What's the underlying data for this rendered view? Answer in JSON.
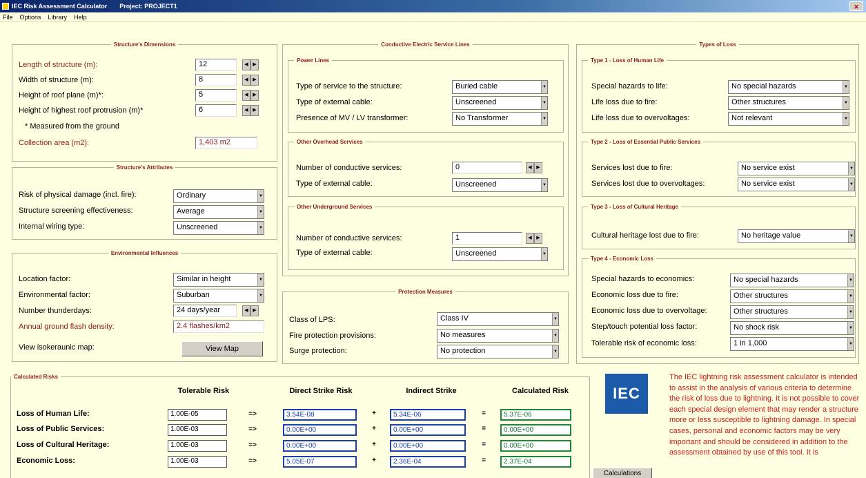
{
  "window": {
    "title": "IEC Risk Assessment Calculator",
    "project": "Project: PROJECT1",
    "close": "✕"
  },
  "menu": [
    "File",
    "Options",
    "Library",
    "Help"
  ],
  "dimensions": {
    "legend": "Structure's Dimensions",
    "length_label": "Length of structure (m):",
    "length_value": "12",
    "width_label": "Width of structure (m):",
    "width_value": "8",
    "height_label": "Height of roof plane (m)*:",
    "height_value": "5",
    "protrusion_label": "Height of highest roof protrusion (m)*",
    "protrusion_value": "6",
    "note": "* Measured from the ground",
    "collection_label": "Collection area (m2):",
    "collection_value": "1,403 m2"
  },
  "attributes": {
    "legend": "Structure's Attributes",
    "risk_label": "Risk of physical damage (incl. fire):",
    "risk_value": "Ordinary",
    "screening_label": "Structure screening effectiveness:",
    "screening_value": "Average",
    "wiring_label": "Internal wiring type:",
    "wiring_value": "Unscreened"
  },
  "environment": {
    "legend": "Environmental Influences",
    "location_label": "Location factor:",
    "location_value": "Similar in height",
    "env_label": "Environmental factor:",
    "env_value": "Suburban",
    "thunder_label": "Number thunderdays:",
    "thunder_value": "24 days/year",
    "flash_label": "Annual ground flash density:",
    "flash_value": "2.4  flashes/km2",
    "map_label": "View isokeraunic map:",
    "map_button": "View Map"
  },
  "services": {
    "legend": "Conductive Electric Service Lines",
    "power_legend": "Power Lines",
    "service_type_label": "Type of service to the structure:",
    "service_type_value": "Buried cable",
    "ext_cable_label": "Type of external cable:",
    "ext_cable_value": "Unscreened",
    "transformer_label": "Presence of MV / LV transformer:",
    "transformer_value": "No Transformer",
    "overhead_legend": "Other Overhead Services",
    "oh_count_label": "Number of conductive services:",
    "oh_count_value": "0",
    "oh_cable_label": "Type of external cable:",
    "oh_cable_value": "Unscreened",
    "ug_legend": "Other Underground Services",
    "ug_count_label": "Number of conductive services:",
    "ug_count_value": "1",
    "ug_cable_label": "Type of external cable:",
    "ug_cable_value": "Unscreened"
  },
  "protection": {
    "legend": "Protection Measures",
    "lps_label": "Class of LPS:",
    "lps_value": "Class IV",
    "fire_label": "Fire protection provisions:",
    "fire_value": "No measures",
    "surge_label": "Surge protection:",
    "surge_value": "No protection"
  },
  "loss": {
    "legend": "Types of Loss",
    "t1_legend": "Type 1 - Loss of Human Life",
    "special_label": "Special hazards to life:",
    "special_value": "No special hazards",
    "lifefire_label": "Life loss due to fire:",
    "lifefire_value": "Other structures",
    "lifeover_label": "Life loss due to overvoltages:",
    "lifeover_value": "Not relevant",
    "t2_legend": "Type 2 - Loss of Essential Public Services",
    "svcfire_label": "Services lost due to fire:",
    "svcfire_value": "No service exist",
    "svcover_label": "Services lost due to overvoltages:",
    "svcover_value": "No service exist",
    "t3_legend": "Type 3 - Loss of Cultural Heritage",
    "heritage_label": "Cultural heritage lost due to fire:",
    "heritage_value": "No heritage value",
    "t4_legend": "Type 4 - Economic Loss",
    "econ_special_label": "Special hazards to economics:",
    "econ_special_value": "No special hazards",
    "econ_fire_label": "Economic loss due to fire:",
    "econ_fire_value": "Other structures",
    "econ_over_label": "Economic loss due to overvoltage:",
    "econ_over_value": "Other structures",
    "step_label": "Step/touch potential loss factor:",
    "step_value": "No shock risk",
    "tolerable_label": "Tolerable risk of economic loss:",
    "tolerable_value": "1 in 1,000"
  },
  "risks": {
    "legend": "Calculated Risks",
    "headers": [
      "Tolerable Risk",
      "Direct Strike Risk",
      "Indirect Strike",
      "Calculated Risk"
    ],
    "rows": [
      {
        "label": "Loss of Human Life:",
        "tolerable": "1.00E-05",
        "direct": "3.54E-08",
        "indirect": "5.34E-06",
        "calculated": "5.37E-06"
      },
      {
        "label": "Loss of Public Services:",
        "tolerable": "1.00E-03",
        "direct": "0.00E+00",
        "indirect": "0.00E+00",
        "calculated": "0.00E+00"
      },
      {
        "label": "Loss of Cultural Heritage:",
        "tolerable": "1.00E-03",
        "direct": "0.00E+00",
        "indirect": "0.00E+00",
        "calculated": "0.00E+00"
      },
      {
        "label": "Economic Loss:",
        "tolerable": "1.00E-03",
        "direct": "5.05E-07",
        "indirect": "2.36E-04",
        "calculated": "2.37E-04"
      }
    ],
    "arrow": "=>",
    "plus": "+",
    "equals": "="
  },
  "logo": "IEC",
  "calc_button": "Calculations",
  "disclaimer": "The IEC lightning risk assessment calculator is intended to assist in the analysis of various criteria to determine the risk of loss due to lightning. It is not possible to cover each special design element that may render a structure more or less susceptible to lightning damage. In special cases, personal and economic factors may be very important and should be considered in addition to the assessment obtained by use of this tool. It is"
}
